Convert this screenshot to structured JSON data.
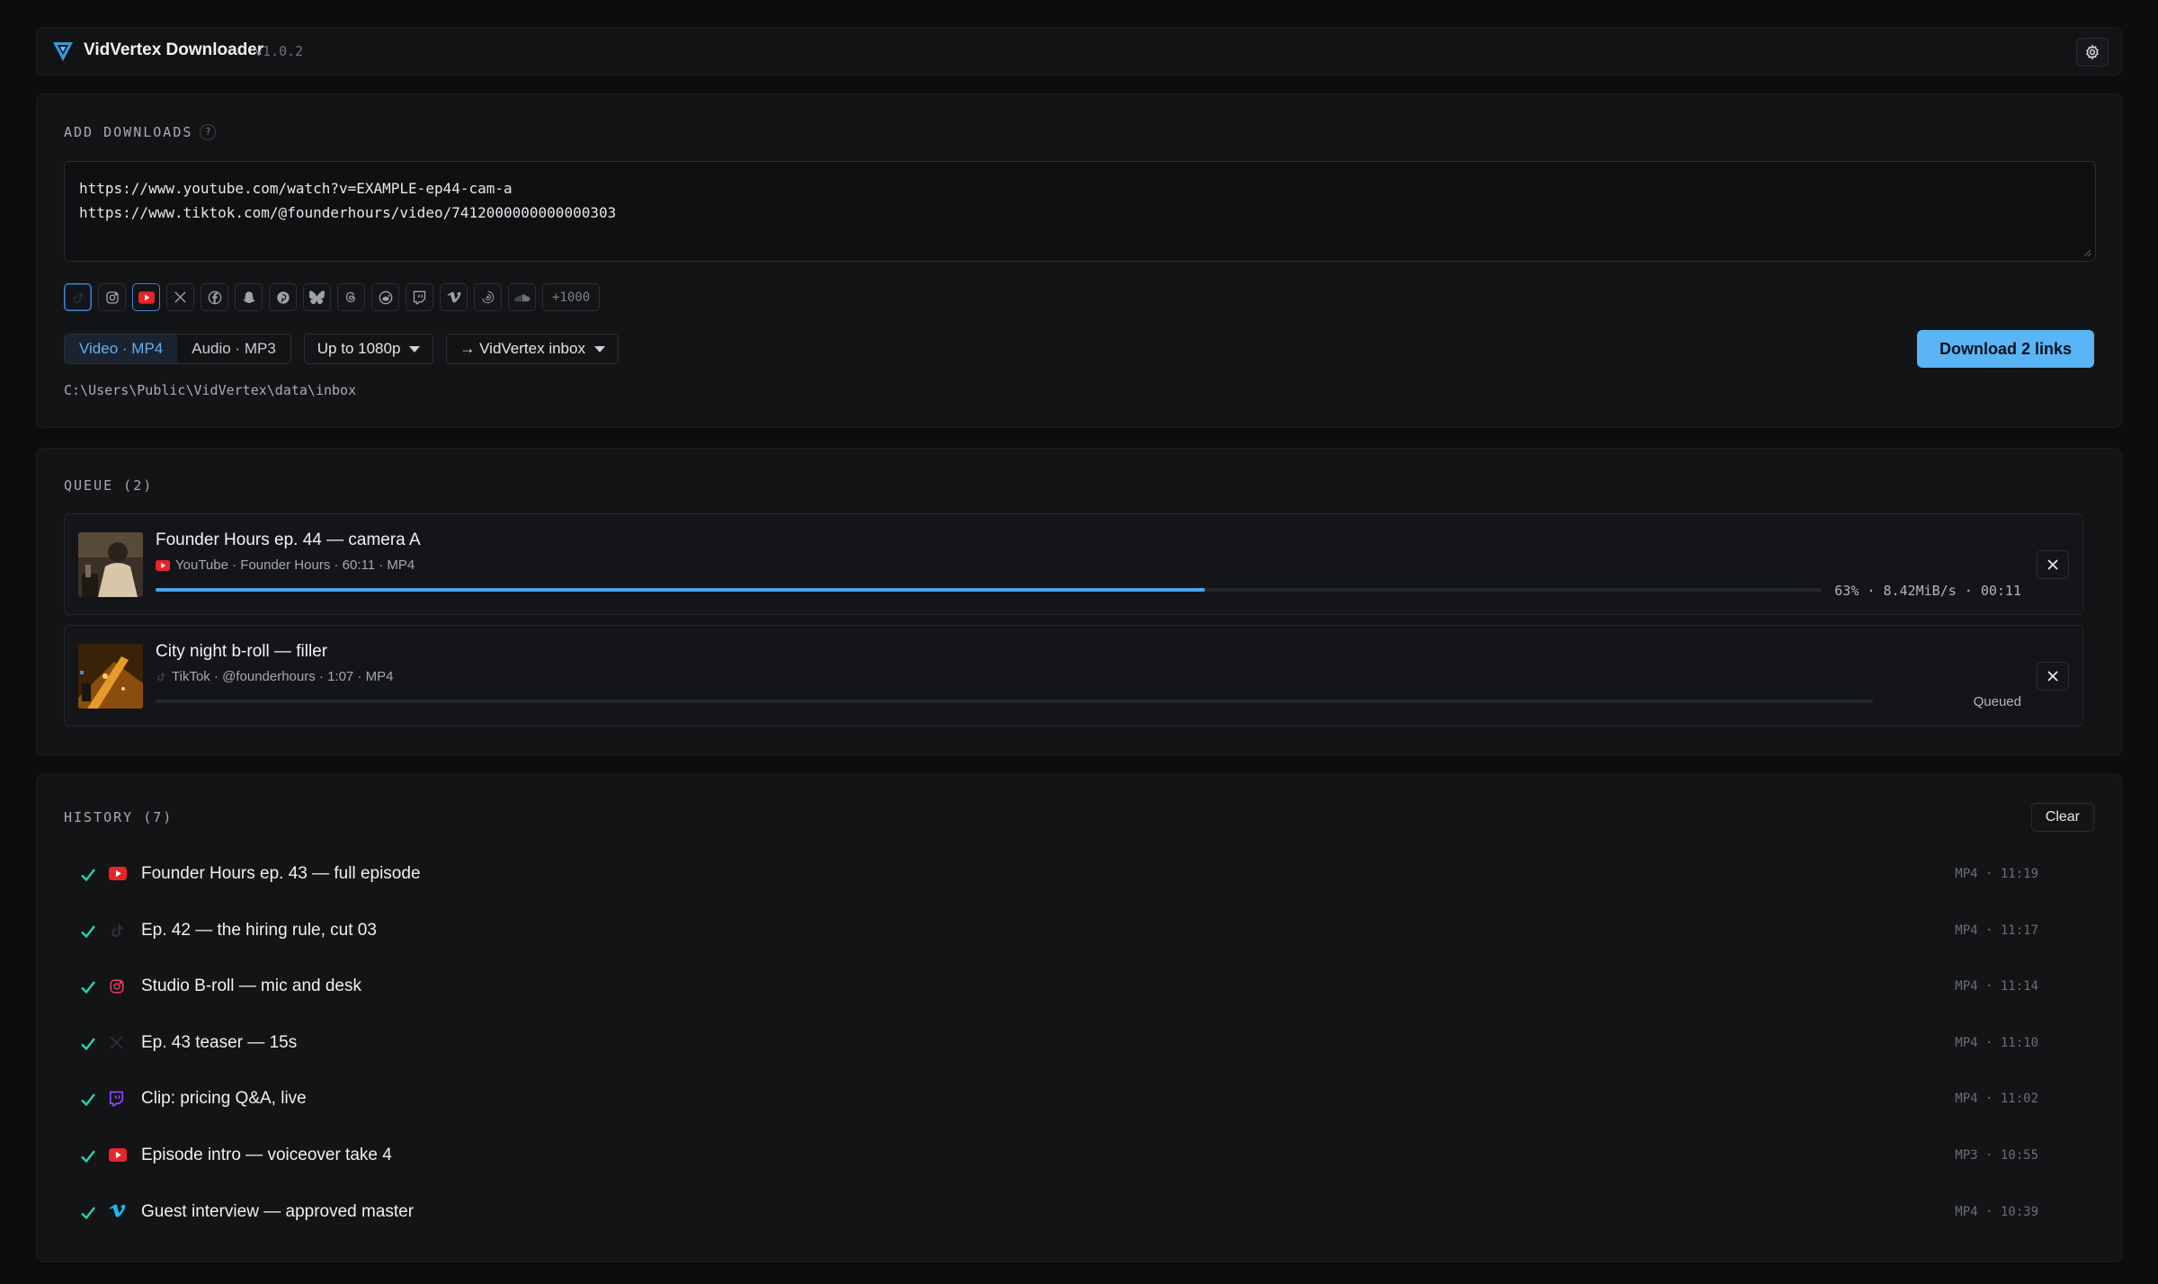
{
  "app": {
    "name": "VidVertex Downloader",
    "version": "v1.0.2"
  },
  "add": {
    "section_title": "ADD DOWNLOADS",
    "help": "?",
    "urls": [
      "https://www.youtube.com/watch?v=EXAMPLE-ep44-cam-a",
      "https://www.tiktok.com/@founderhours/video/7412000000000000303"
    ],
    "platforms": [
      "tiktok",
      "instagram",
      "youtube",
      "x",
      "facebook",
      "snapchat",
      "pinterest",
      "bluesky",
      "threads",
      "reddit",
      "twitch",
      "vimeo",
      "dailymotion",
      "soundcloud"
    ],
    "more_platforms": "+1000",
    "format_video": "Video · MP4",
    "format_audio": "Audio · MP3",
    "quality": "Up to 1080p",
    "destination": "→ VidVertex inbox",
    "download_button": "Download 2 links",
    "path": "C:\\Users\\Public\\VidVertex\\data\\inbox"
  },
  "queue": {
    "section_title": "QUEUE (2)",
    "items": [
      {
        "title": "Founder Hours ep. 44 — camera A",
        "platform": "youtube",
        "meta": "YouTube · Founder Hours · 60:11 · MP4",
        "progress": 0.63,
        "status": "63% · 8.42MiB/s · 00:11"
      },
      {
        "title": "City night b-roll — filler",
        "platform": "tiktok",
        "meta": "TikTok · @founderhours · 1:07 · MP4",
        "progress": 0,
        "status": "Queued"
      }
    ]
  },
  "history": {
    "section_title": "HISTORY (7)",
    "clear_button": "Clear",
    "items": [
      {
        "title": "Founder Hours ep. 43 — full episode",
        "platform": "youtube",
        "meta": "MP4 · 11:19"
      },
      {
        "title": "Ep. 42 — the hiring rule, cut 03",
        "platform": "tiktok",
        "meta": "MP4 · 11:17"
      },
      {
        "title": "Studio B-roll — mic and desk",
        "platform": "instagram",
        "meta": "MP4 · 11:14"
      },
      {
        "title": "Ep. 43 teaser — 15s",
        "platform": "x",
        "meta": "MP4 · 11:10"
      },
      {
        "title": "Clip: pricing Q&A, live",
        "platform": "twitch",
        "meta": "MP4 · 11:02"
      },
      {
        "title": "Episode intro — voiceover take 4",
        "platform": "youtube",
        "meta": "MP3 · 10:55"
      },
      {
        "title": "Guest interview — approved master",
        "platform": "vimeo",
        "meta": "MP4 · 10:39"
      }
    ]
  },
  "colors": {
    "accent": "#59b5f5",
    "progress": "#4aa3ea",
    "success": "#2fd3a2",
    "youtube": "#e5252a",
    "instagram": "#e4405f",
    "twitch": "#9146ff",
    "vimeo": "#1ab7ea"
  }
}
